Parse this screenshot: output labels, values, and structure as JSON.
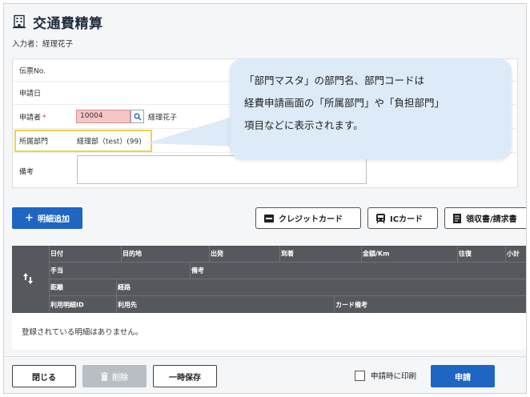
{
  "header": {
    "title": "交通費精算",
    "entrant_label": "入力者：",
    "entrant_name": "経理花子"
  },
  "form": {
    "slip_no_label": "伝票No.",
    "apply_date_label": "申請日",
    "applicant_label": "申請者",
    "required_mark": "*",
    "applicant_code": "10004",
    "applicant_name": "経理花子",
    "dept_label": "所属部門",
    "dept_value": "経理部（test）(99)",
    "remark_label": "備考",
    "remark_value": ""
  },
  "callout": {
    "text": "「部門マスタ」の部門名、部門コードは\n経費申請画面の「所属部門」や「負担部門」\n項目などに表示されます。"
  },
  "actions": {
    "add_detail": "明細追加",
    "credit_card": "クレジットカード",
    "ic_card": "ICカード",
    "receipt": "領収書/請求書"
  },
  "detail_table": {
    "row1": [
      "日付",
      "目的地",
      "出発",
      "到着",
      "金額/Km",
      "往復",
      "小計"
    ],
    "row2": [
      "手当",
      "備考"
    ],
    "row3": [
      "距離",
      "経路"
    ],
    "row4": [
      "利用明細ID",
      "利用先",
      "カード備考"
    ],
    "empty_message": "登録されている明細はありません。"
  },
  "footer": {
    "close": "閉じる",
    "delete": "削除",
    "temp_save": "一時保存",
    "print_on_submit": "申請時に印刷",
    "submit": "申請"
  },
  "colors": {
    "primary": "#1f66c2",
    "highlight": "#f0d24e",
    "callout_bg": "#ddeaf7",
    "table_header": "#55585c",
    "required_input": "#f5c6c6"
  }
}
